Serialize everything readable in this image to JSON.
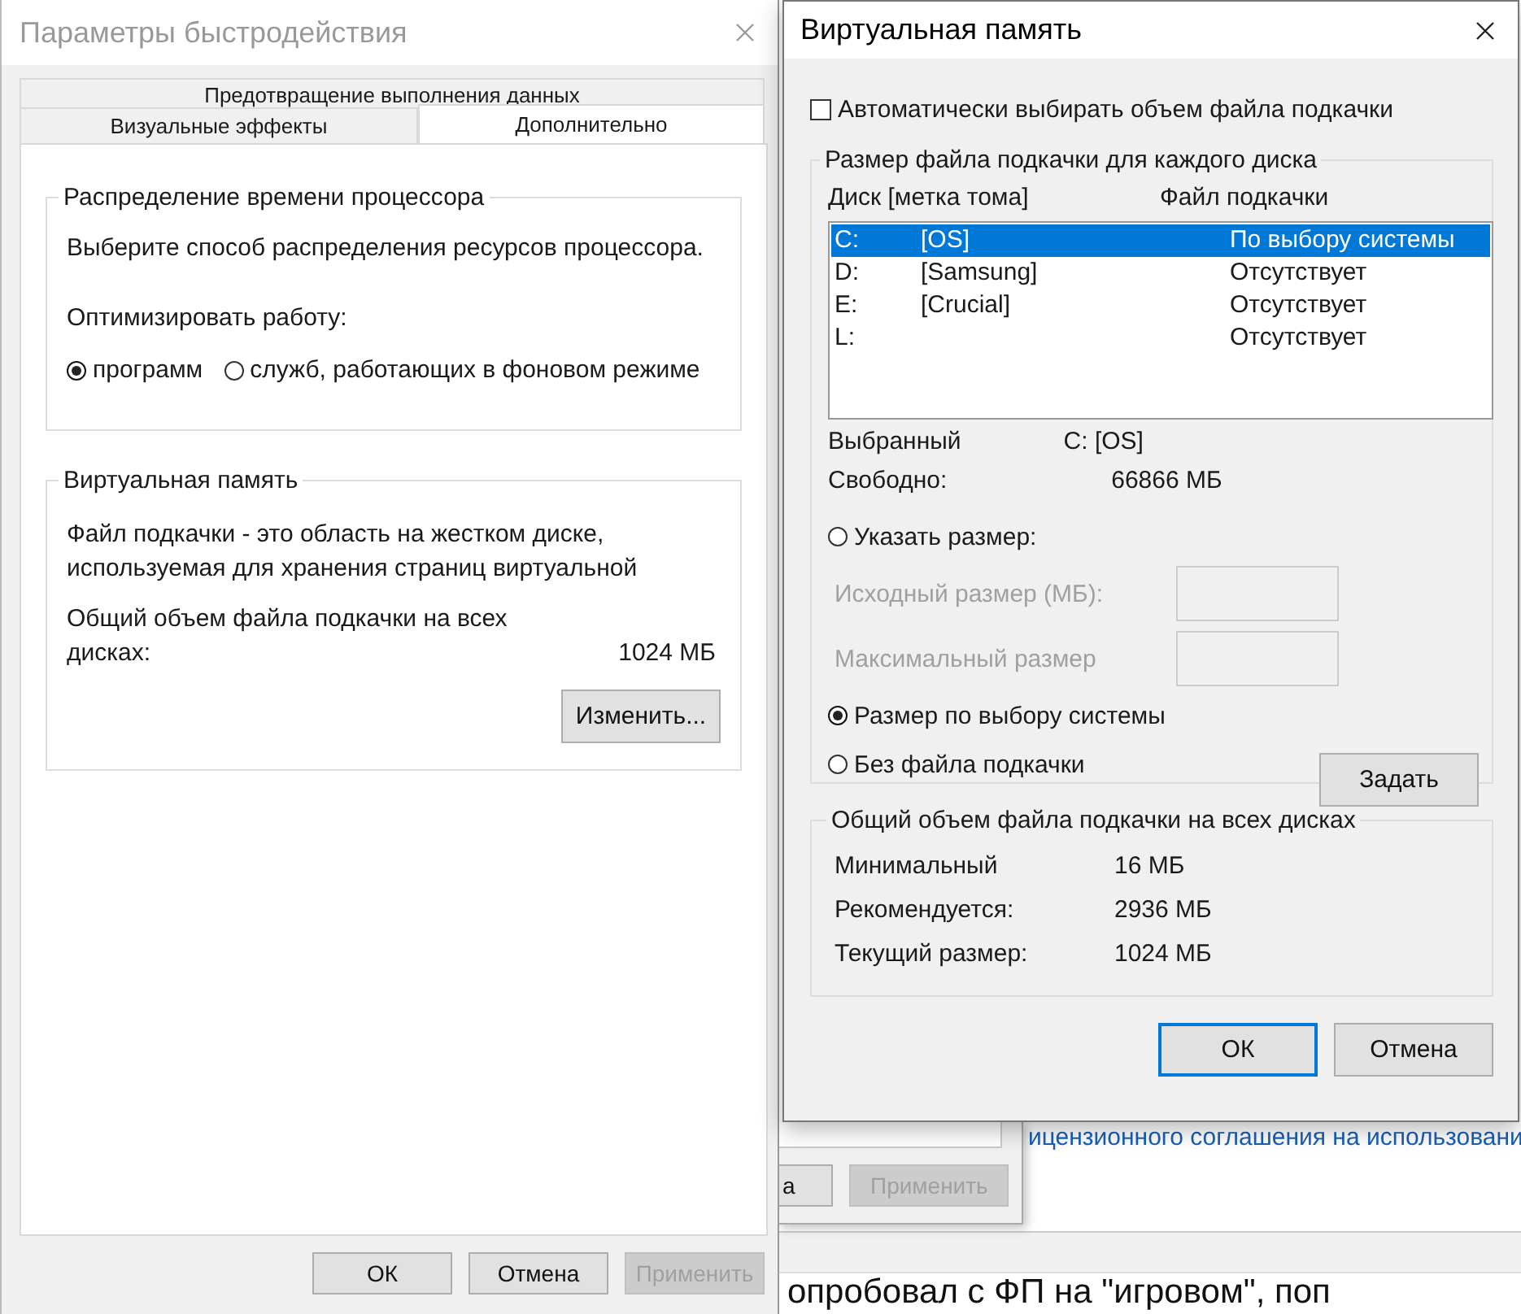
{
  "background": {
    "link_text": "ицензионного соглашения на использовани",
    "dialog_buttons": [
      {
        "label": "а",
        "disabled": false
      },
      {
        "label": "Применить",
        "disabled": true
      }
    ],
    "bottom_text": "опробовал с ФП на \"игровом\", поп"
  },
  "performance_window": {
    "title": "Параметры быстродействия",
    "tabs_top": [
      {
        "label": "Предотвращение выполнения данных",
        "selected": false
      }
    ],
    "tabs": [
      {
        "label": "Визуальные эффекты",
        "selected": false
      },
      {
        "label": "Дополнительно",
        "selected": true
      }
    ],
    "cpu_group": {
      "title": "Распределение времени процессора",
      "description": "Выберите способ распределения ресурсов процессора.",
      "optimize_label": "Оптимизировать работу:",
      "options": [
        {
          "label": "программ",
          "selected": true
        },
        {
          "label": "служб, работающих в фоновом режиме",
          "selected": false
        }
      ]
    },
    "vm_group": {
      "title": "Виртуальная память",
      "description": [
        "Файл подкачки - это область на жестком диске,",
        "используемая для хранения страниц виртуальной"
      ],
      "total_label": [
        "Общий объем файла подкачки на всех",
        "дисках:"
      ],
      "total_value": "1024 МБ",
      "change_button": "Изменить..."
    },
    "buttons": [
      {
        "label": "ОК",
        "disabled": false
      },
      {
        "label": "Отмена",
        "disabled": false
      },
      {
        "label": "Применить",
        "disabled": true
      }
    ]
  },
  "virtual_memory_window": {
    "title": "Виртуальная память",
    "auto_checkbox": {
      "label": "Автоматически выбирать объем файла подкачки",
      "checked": false
    },
    "drives_group": {
      "title": "Размер файла подкачки для каждого диска",
      "columns": [
        "Диск [метка тома]",
        "Файл подкачки"
      ],
      "drives": [
        {
          "drive": "C:",
          "label": "[OS]",
          "paging": "По выбору системы",
          "selected": true
        },
        {
          "drive": "D:",
          "label": "[Samsung]",
          "paging": "Отсутствует",
          "selected": false
        },
        {
          "drive": "E:",
          "label": "[Crucial]",
          "paging": "Отсутствует",
          "selected": false
        },
        {
          "drive": "L:",
          "paging": "Отсутствует",
          "selected": false
        }
      ],
      "selected_label": "Выбранный",
      "selected_value": "C:  [OS]",
      "free_label": "Свободно:",
      "free_value": "66866 МБ",
      "size_options": [
        {
          "kind": "radio",
          "label": "Указать размер:",
          "selected": false
        },
        {
          "kind": "field",
          "label": "Исходный размер (МБ):",
          "disabled": true
        },
        {
          "kind": "field",
          "label": "Максимальный размер",
          "disabled": true
        },
        {
          "kind": "radio",
          "label": "Размер по выбору системы",
          "selected": true
        },
        {
          "kind": "radio",
          "label": "Без файла подкачки",
          "selected": false
        }
      ],
      "set_button": "Задать"
    },
    "totals_group": {
      "title": "Общий объем файла подкачки на всех дисках",
      "rows": [
        {
          "label": "Минимальный",
          "value": "16 МБ"
        },
        {
          "label": "Рекомендуется:",
          "value": "2936 МБ"
        },
        {
          "label": "Текущий размер:",
          "value": "1024 МБ"
        }
      ]
    },
    "buttons": [
      {
        "label": "ОК",
        "default": true
      },
      {
        "label": "Отмена",
        "default": false
      }
    ]
  }
}
